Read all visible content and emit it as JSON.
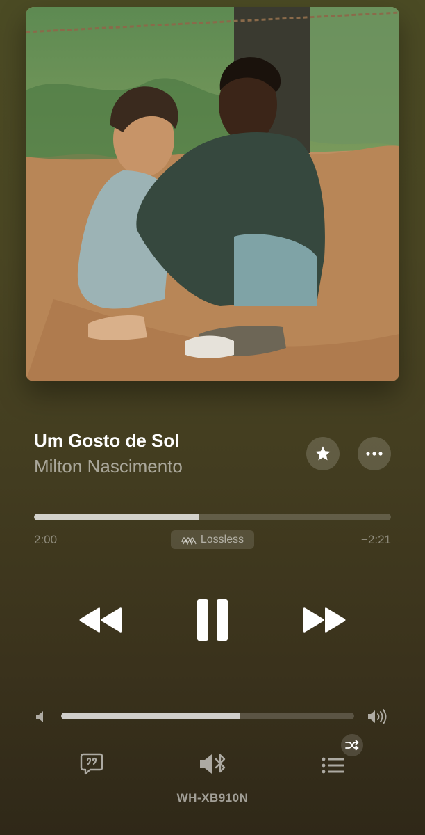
{
  "now_playing": {
    "title": "Um Gosto de Sol",
    "artist": "Milton Nascimento"
  },
  "actions": {
    "favorite_icon": "star-icon",
    "more_icon": "ellipsis-icon"
  },
  "progress": {
    "elapsed": "2:00",
    "remaining": "−2:21",
    "fraction": 0.463,
    "badge_label": "Lossless",
    "badge_icon": "lossless-wave-icon"
  },
  "transport": {
    "rewind_icon": "backward-icon",
    "pause_icon": "pause-icon",
    "forward_icon": "forward-icon"
  },
  "volume": {
    "fraction": 0.61,
    "low_icon": "speaker-low-icon",
    "high_icon": "speaker-high-icon"
  },
  "bottom_bar": {
    "lyrics_icon": "lyrics-bubble-icon",
    "output_icon": "bluetooth-speaker-icon",
    "queue_icon": "queue-list-icon",
    "shuffle_icon": "shuffle-icon",
    "device_name": "WH-XB910N"
  },
  "colors": {
    "background_top": "#4b4b24",
    "background_bottom": "#2f2818",
    "text_primary": "#ffffff",
    "text_secondary": "rgba(255,255,255,0.55)"
  }
}
